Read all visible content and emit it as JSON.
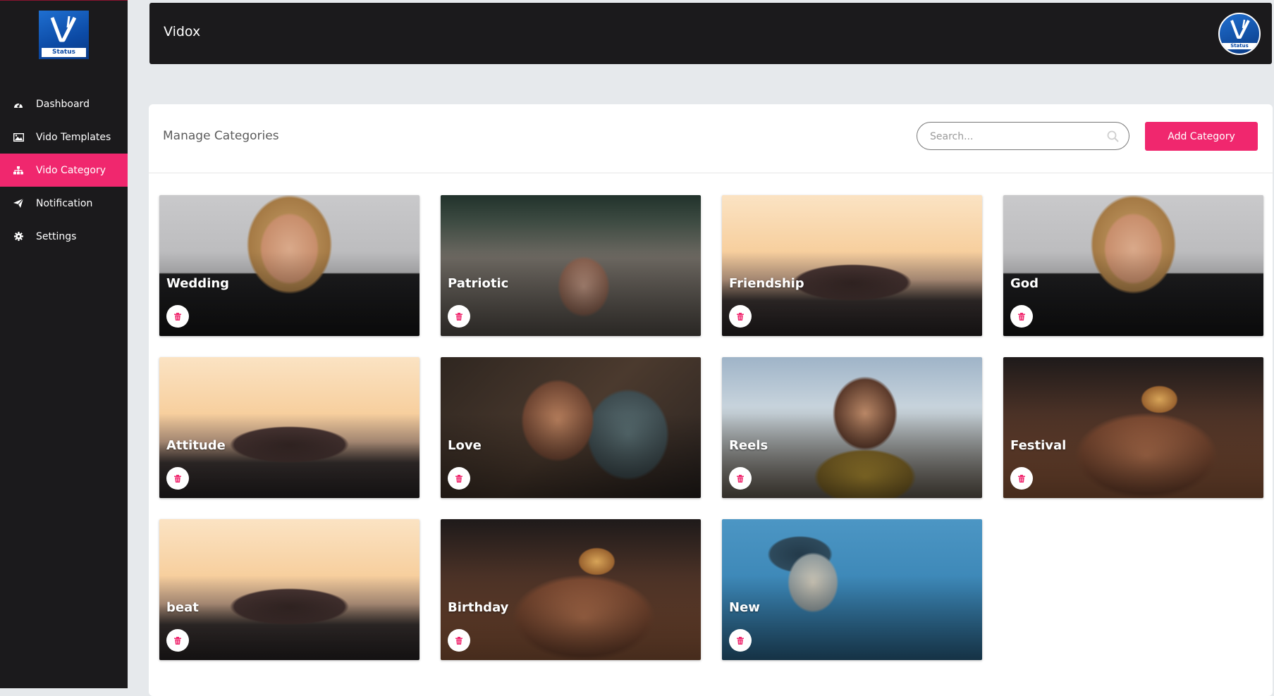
{
  "brand": {
    "logo_text": "Status",
    "avatar_text": "Status"
  },
  "header": {
    "title": "Vidox"
  },
  "sidebar": {
    "items": [
      {
        "label": "Dashboard",
        "icon": "dashboard-icon",
        "active": false
      },
      {
        "label": "Vido Templates",
        "icon": "image-icon",
        "active": false
      },
      {
        "label": "Vido Category",
        "icon": "sitemap-icon",
        "active": true
      },
      {
        "label": "Notification",
        "icon": "paper-plane-icon",
        "active": false
      },
      {
        "label": "Settings",
        "icon": "gear-icon",
        "active": false
      }
    ]
  },
  "panel": {
    "title": "Manage Categories",
    "search_placeholder": "Search...",
    "add_button": "Add Category"
  },
  "categories": [
    {
      "name": "Wedding",
      "image": "portrait"
    },
    {
      "name": "Patriotic",
      "image": "forest"
    },
    {
      "name": "Friendship",
      "image": "sunset"
    },
    {
      "name": "God",
      "image": "portrait"
    },
    {
      "name": "Attitude",
      "image": "sunset"
    },
    {
      "name": "Love",
      "image": "love"
    },
    {
      "name": "Reels",
      "image": "reels"
    },
    {
      "name": "Festival",
      "image": "festival"
    },
    {
      "name": "beat",
      "image": "sunset"
    },
    {
      "name": "Birthday",
      "image": "festival"
    },
    {
      "name": "New",
      "image": "water"
    }
  ],
  "colors": {
    "accent": "#f0276e",
    "sidebar_bg": "#1b1a1c",
    "page_bg": "#e6e9ec"
  }
}
